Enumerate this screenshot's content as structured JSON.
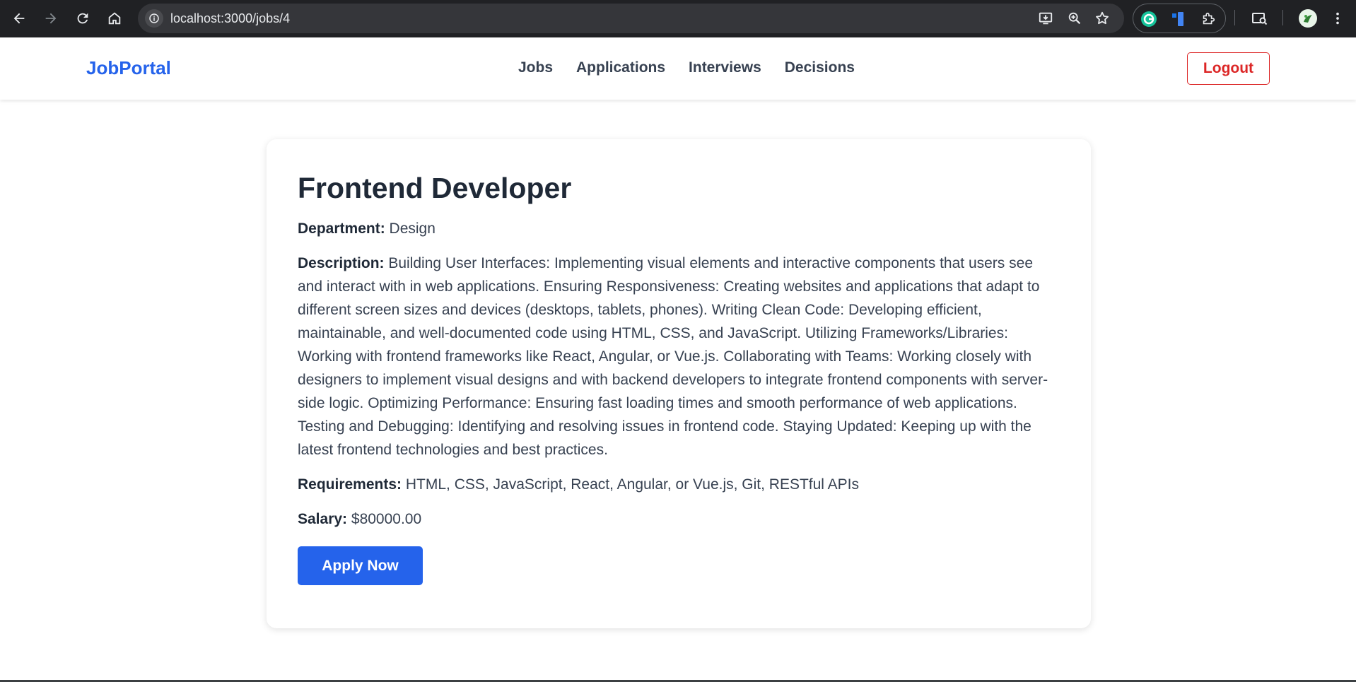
{
  "browser": {
    "url": "localhost:3000/jobs/4",
    "icons": [
      "back-icon",
      "forward-icon",
      "reload-icon",
      "home-icon",
      "site-info-icon",
      "install-app-icon",
      "zoom-icon",
      "bookmark-star-icon",
      "grammarly-icon",
      "extension-icon",
      "puzzle-extensions-icon",
      "tab-search-icon",
      "profile-avatar",
      "menu-kebab-icon"
    ]
  },
  "navbar": {
    "brand": "JobPortal",
    "links": [
      "Jobs",
      "Applications",
      "Interviews",
      "Decisions"
    ],
    "logout_label": "Logout"
  },
  "job": {
    "title": "Frontend Developer",
    "department_label": "Department:",
    "department": "Design",
    "description_label": "Description:",
    "description": "Building User Interfaces: Implementing visual elements and interactive components that users see and interact with in web applications. Ensuring Responsiveness: Creating websites and applications that adapt to different screen sizes and devices (desktops, tablets, phones). Writing Clean Code: Developing efficient, maintainable, and well-documented code using HTML, CSS, and JavaScript. Utilizing Frameworks/Libraries: Working with frontend frameworks like React, Angular, or Vue.js. Collaborating with Teams: Working closely with designers to implement visual designs and with backend developers to integrate frontend components with server-side logic. Optimizing Performance: Ensuring fast loading times and smooth performance of web applications. Testing and Debugging: Identifying and resolving issues in frontend code. Staying Updated: Keeping up with the latest frontend technologies and best practices.",
    "requirements_label": "Requirements:",
    "requirements": "HTML, CSS, JavaScript, React, Angular, or Vue.js, Git, RESTful APIs",
    "salary_label": "Salary:",
    "salary": "$80000.00",
    "apply_label": "Apply Now"
  },
  "colors": {
    "brand": "#2563eb",
    "logout": "#dc2626",
    "apply_button": "#2563eb",
    "text_dark": "#1f2937",
    "browser_chrome": "#202124"
  }
}
